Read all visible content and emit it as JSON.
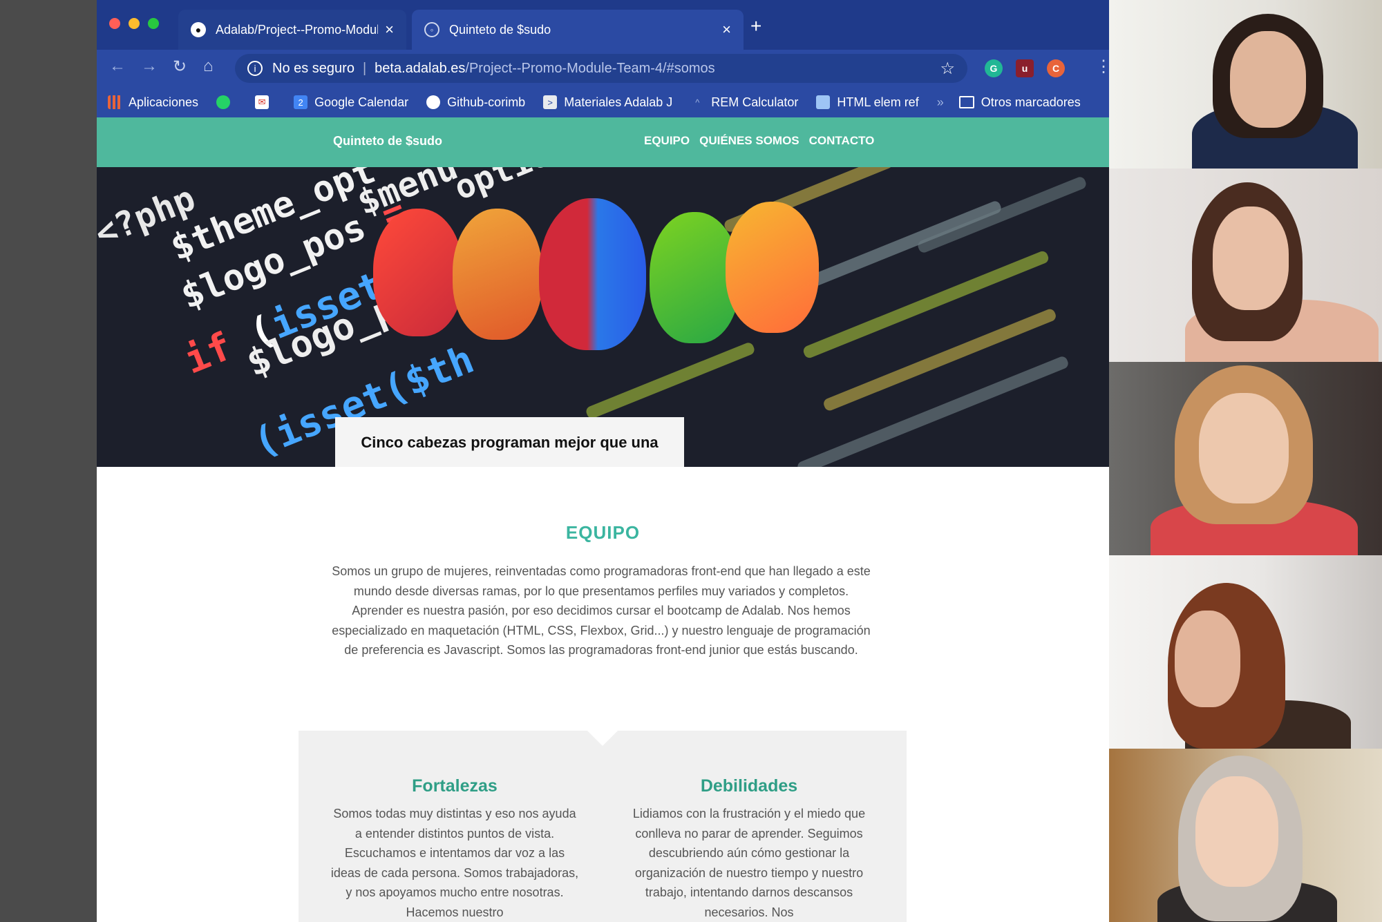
{
  "browser": {
    "tabs": [
      {
        "title": "Adalab/Project--Promo-Modul",
        "active": false
      },
      {
        "title": "Quinteto de $sudo",
        "active": true
      }
    ],
    "address": {
      "security": "No es seguro",
      "host": "beta.adalab.es",
      "path": "/Project--Promo-Module-Team-4/#somos"
    },
    "profile_initial": "C",
    "bookmarks": [
      {
        "label": "Aplicaciones",
        "icon": "apps-icon"
      },
      {
        "label": "Google Calendar",
        "icon": "calendar-icon"
      },
      {
        "label": "Github-corimb",
        "icon": "github-icon"
      },
      {
        "label": "Materiales Adalab J",
        "icon": "doc-icon"
      },
      {
        "label": "REM Calculator",
        "icon": "calc-icon"
      },
      {
        "label": "HTML elem ref",
        "icon": "html-icon"
      }
    ],
    "other_bookmarks": "Otros marcadores"
  },
  "site": {
    "brand": "Quinteto de $sudo",
    "nav": [
      "EQUIPO",
      "QUIÉNES SOMOS",
      "CONTACTO"
    ],
    "hero_caption": "Cinco cabezas programan mejor que una",
    "team_title": "EQUIPO",
    "team_body": "Somos un grupo de mujeres, reinventadas como programadoras front-end que han llegado a este mundo desde diversas ramas, por lo que presentamos perfiles muy variados y completos. Aprender es nuestra pasión, por eso decidimos cursar el bootcamp de Adalab. Nos hemos especializado en maquetación (HTML, CSS, Flexbox, Grid...) y nuestro lenguaje de programación de preferencia es Javascript. Somos las programadoras front-end junior que estás buscando.",
    "strengths_title": "Fortalezas",
    "strengths_body": "Somos todas muy distintas y eso nos ayuda a entender distintos puntos de vista. Escuchamos e intentamos dar voz a las ideas de cada persona. Somos trabajadoras, y nos apoyamos mucho entre nosotras. Hacemos nuestro",
    "weaknesses_title": "Debilidades",
    "weaknesses_body": "Lidiamos con la frustración y el miedo que conlleva no parar de aprender. Seguimos descubriendo aún cómo gestionar la organización de nuestro tiempo y nuestro trabajo, intentando darnos descansos necesarios. Nos"
  },
  "colors": {
    "accent": "#4fb89d",
    "title_teal": "#3bb5a0",
    "browser_blue": "#2b4aa3"
  }
}
